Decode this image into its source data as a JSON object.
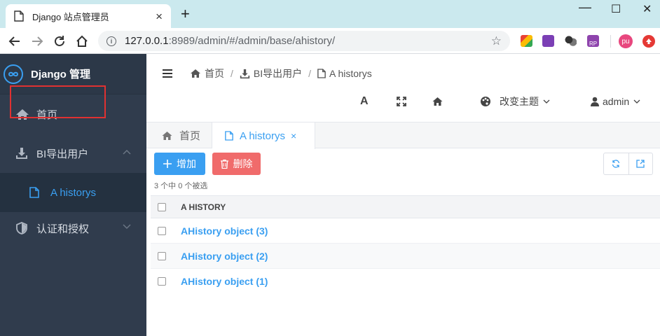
{
  "browser": {
    "tab_title": "Django 站点管理员",
    "tab_close": "×",
    "new_tab": "+",
    "win_min": "—",
    "win_max": "☐",
    "win_close": "✕",
    "url_host": "127.0.0.1",
    "url_rest": ":8989/admin/#/admin/base/ahistory/",
    "info_glyph": "i",
    "star_glyph": "☆",
    "ext_pu_label": "pu",
    "ext_rp_label": "RP"
  },
  "sidebar": {
    "brand": "Django 管理",
    "items": [
      {
        "label": "首页",
        "icon": "home-icon"
      },
      {
        "label": "BI导出用户",
        "icon": "download-icon"
      },
      {
        "label": "A historys",
        "icon": "file-icon"
      },
      {
        "label": "认证和授权",
        "icon": "shield-icon"
      }
    ]
  },
  "header": {
    "breadcrumbs": [
      "首页",
      "BI导出用户",
      "A historys"
    ],
    "breadcrumb_sep": "/",
    "font_tool": "A",
    "theme_label": "改变主题",
    "user_label": "admin"
  },
  "page_tabs": [
    {
      "label": "首页"
    },
    {
      "label": "A historys",
      "close": "×"
    }
  ],
  "toolbar": {
    "add_label": "增加",
    "delete_label": "删除",
    "selection_text": "3 个中 0 个被选"
  },
  "table": {
    "column_header": "A HISTORY",
    "rows": [
      "AHistory object (3)",
      "AHistory object (2)",
      "AHistory object (1)"
    ]
  },
  "colors": {
    "accent": "#3a9ff1",
    "danger": "#f06b6b",
    "sidebar_bg": "#303c4d",
    "highlight": "#e03131"
  }
}
